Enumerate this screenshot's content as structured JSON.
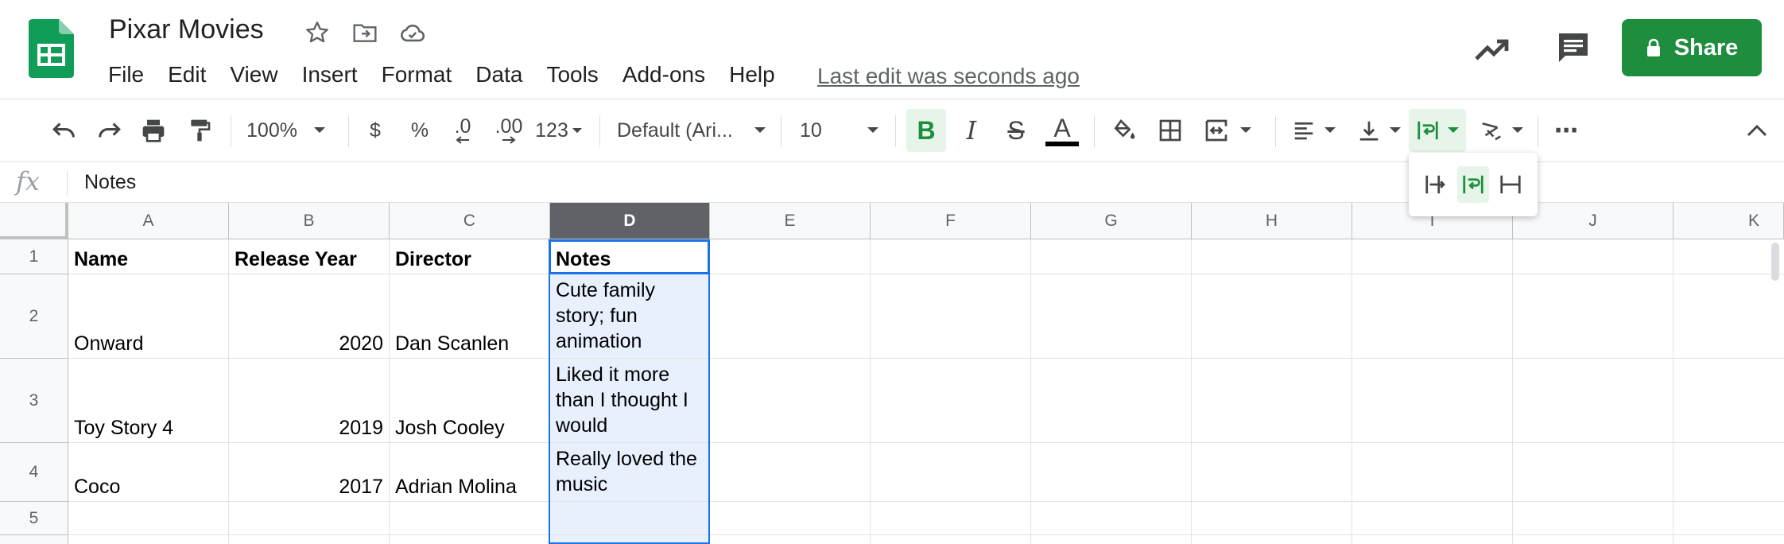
{
  "app": {
    "doc_title": "Pixar Movies",
    "last_edit": "Last edit was seconds ago",
    "share_label": "Share",
    "colors": {
      "accent": "#1e8e3e",
      "selection": "#1a73e8",
      "selected_fill": "#e8f0fe"
    }
  },
  "menu": [
    "File",
    "Edit",
    "View",
    "Insert",
    "Format",
    "Data",
    "Tools",
    "Add-ons",
    "Help"
  ],
  "toolbar": {
    "zoom": "100%",
    "currency": "$",
    "percent": "%",
    "dec_decrease": ".0",
    "dec_increase": ".00",
    "more_formats": "123",
    "font": "Default (Ari...",
    "font_size": "10",
    "bold": "B",
    "italic": "I",
    "strike": "S",
    "text_color": "A",
    "more": "⋯"
  },
  "formula_bar": {
    "fx": "fx",
    "value": "Notes"
  },
  "columns": [
    "A",
    "B",
    "C",
    "D",
    "E",
    "F",
    "G",
    "H",
    "I",
    "J",
    "K"
  ],
  "rows": [
    "1",
    "2",
    "3",
    "4",
    "5"
  ],
  "cells": [
    [
      "Name",
      "Release Year",
      "Director",
      "Notes"
    ],
    [
      "Onward",
      "2020",
      "Dan Scanlen",
      "Cute family story; fun animation"
    ],
    [
      "Toy Story 4",
      "2019",
      "Josh Cooley",
      "Liked it more than I thought I would"
    ],
    [
      "Coco",
      "2017",
      "Adrian Molina",
      "Really loved the music"
    ],
    [
      "",
      "",
      "",
      ""
    ]
  ]
}
